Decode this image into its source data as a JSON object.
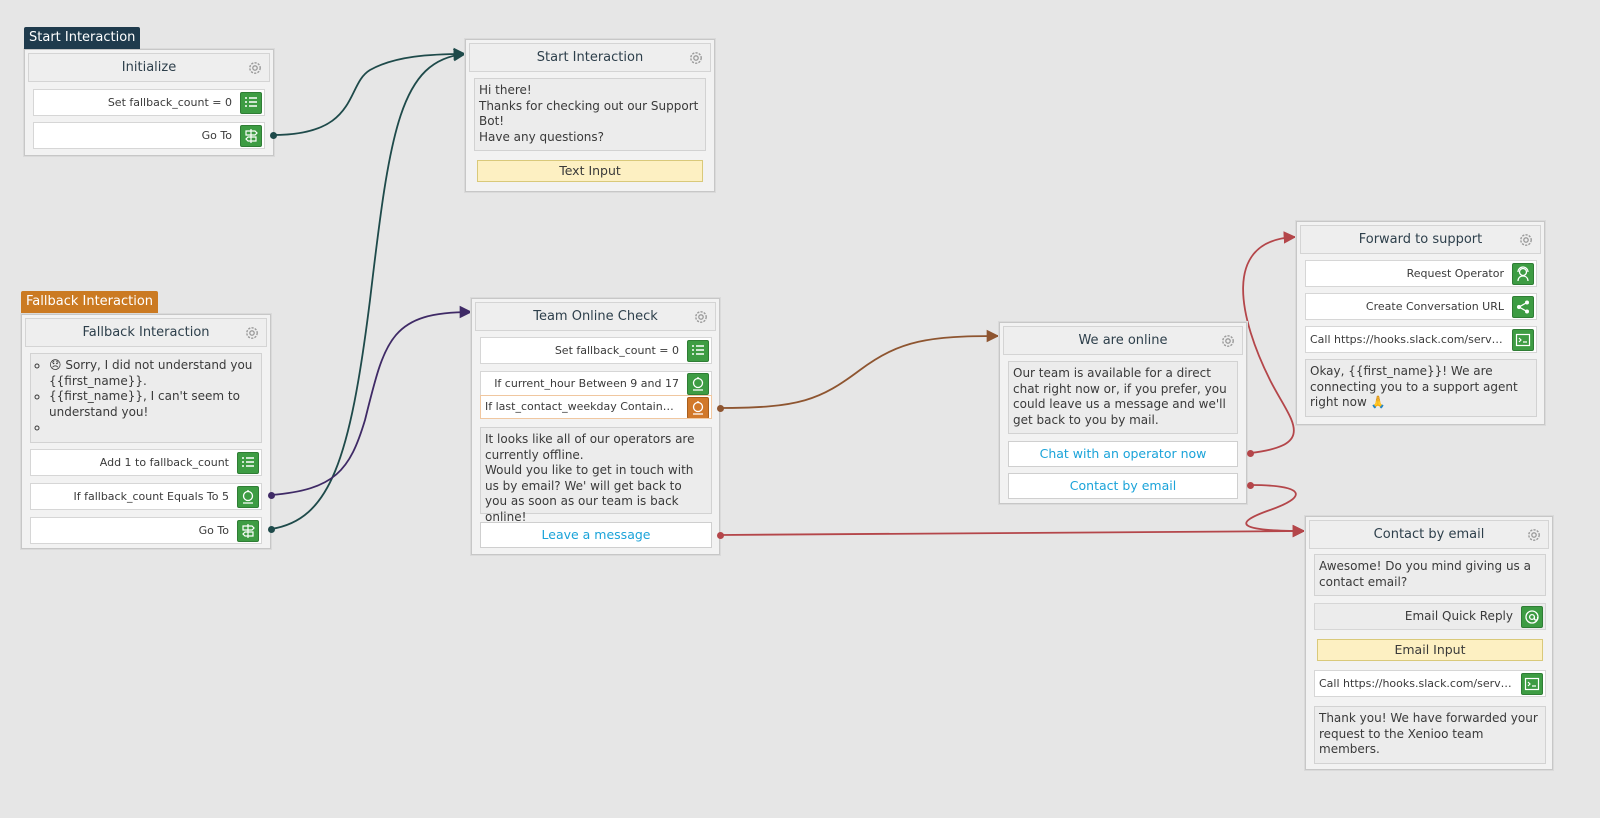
{
  "colors": {
    "canvas": "#e6e6e6",
    "tag_start": "#1f3b4d",
    "tag_fallback": "#cb7a22",
    "icon_green": "#3d9c43",
    "icon_orange": "#d1782a",
    "link_blue": "#1aa3d9",
    "input_yellow": "#fdf0c2",
    "wire_dark_teal": "#1e4a4a",
    "wire_purple": "#3f2a66",
    "wire_brown": "#8e5530",
    "wire_red": "#b4464a"
  },
  "tags": {
    "start": "Start Interaction",
    "fallback": "Fallback Interaction"
  },
  "nodes": {
    "initialize": {
      "title": "Initialize",
      "rows": [
        {
          "label": "Set fallback_count = 0",
          "icon": "variable-list-icon"
        },
        {
          "label": "Go To",
          "icon": "signpost-icon"
        }
      ]
    },
    "start_interaction": {
      "title": "Start Interaction",
      "message": [
        "Hi there!",
        "Thanks for checking out our Support Bot!",
        "Have any questions?"
      ],
      "input": "Text Input"
    },
    "fallback": {
      "title": "Fallback Interaction",
      "message_items": [
        "😞 Sorry, I did not understand you {{first_name}}.",
        "{{first_name}}, I can't seem to understand you!",
        ""
      ],
      "rows": [
        {
          "label": "Add 1 to fallback_count",
          "icon": "variable-list-icon"
        },
        {
          "label": "If fallback_count Equals To 5",
          "icon": "condition-icon"
        },
        {
          "label": "Go To",
          "icon": "signpost-icon"
        }
      ]
    },
    "team_online": {
      "title": "Team Online Check",
      "rows": [
        {
          "label": "Set fallback_count = 0",
          "icon": "variable-list-icon"
        },
        {
          "label": "If current_hour Between 9 and 17",
          "icon": "condition-icon"
        },
        {
          "label": "If last_contact_weekday Contains mon...",
          "icon": "condition-icon"
        }
      ],
      "message": [
        "It looks like all of our operators are currently offline.",
        "Would you like to get in touch with us by email? We' will get back to you as soon as our team is back online!"
      ],
      "button": "Leave a message"
    },
    "we_are_online": {
      "title": "We are online",
      "message": "Our team is available for a direct chat right now or, if you prefer, you could leave us a message and we'll get back to you by mail.",
      "buttons": [
        "Chat with an operator now",
        "Contact by email"
      ]
    },
    "forward_support": {
      "title": "Forward to support",
      "rows": [
        {
          "label": "Request Operator",
          "icon": "operator-icon"
        },
        {
          "label": "Create Conversation URL",
          "icon": "share-icon"
        },
        {
          "label": "Call https://hooks.slack.com/services/...",
          "icon": "webhook-icon"
        }
      ],
      "message": "Okay, {{first_name}}! We are connecting you to a support agent right now 🙏"
    },
    "contact_email": {
      "title": "Contact by email",
      "message": "Awesome! Do you mind giving us a contact email?",
      "quick_reply": {
        "label": "Email Quick Reply",
        "icon": "at-sign-icon"
      },
      "input": "Email Input",
      "webhook": {
        "label": "Call https://hooks.slack.com/services/...",
        "icon": "webhook-icon"
      },
      "final_message": "Thank you! We have forwarded your request to the Xenioo team members."
    }
  }
}
